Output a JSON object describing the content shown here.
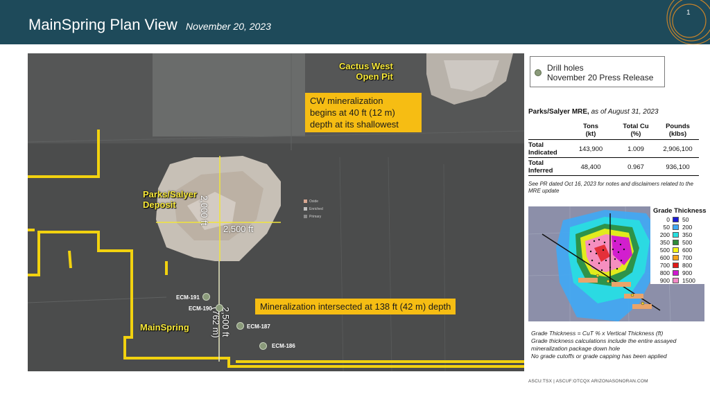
{
  "header": {
    "title": "MainSpring Plan View",
    "date": "November 20, 2023",
    "page_number": "1"
  },
  "map": {
    "labels": {
      "cactus_west": "Cactus West\nOpen Pit",
      "parks_salyer": "Parks/Salyer\nDeposit",
      "mainspring": "MainSpring"
    },
    "callouts": {
      "cw_mineralization": "CW mineralization\nbegins at 40 ft (12 m)\ndepth at its shallowest",
      "mineralization_intersected": "Mineralization intersected at 138 ft (42 m) depth"
    },
    "dimensions": {
      "vertical": "2,000 ft",
      "horizontal": "2,500 ft",
      "mainspring": "2,500 ft\n(762 m)"
    },
    "mini_legend": [
      "Oxide",
      "Enriched",
      "Primary"
    ],
    "drill_holes": [
      "ECM-191",
      "ECM-190",
      "ECM-187",
      "ECM-186"
    ]
  },
  "drill_legend": {
    "line1": "Drill holes",
    "line2": "November 20 Press Release"
  },
  "mre": {
    "title_bold": "Parks/Salyer  MRE,",
    "title_italic": " as of August 31, 2023",
    "columns": [
      "",
      "Tons\n(kt)",
      "Total Cu\n(%)",
      "Pounds\n(klbs)"
    ],
    "rows": [
      {
        "label": "Total\nIndicated",
        "tons": "143,900",
        "cu": "1.009",
        "pounds": "2,906,100"
      },
      {
        "label": "Total\nInferred",
        "tons": "48,400",
        "cu": "0.967",
        "pounds": "936,100"
      }
    ],
    "note": "See PR dated Oct 16, 2023 for notes and disclaimers related to the MRE update"
  },
  "grade_thickness": {
    "title": "Grade Thickness",
    "bins": [
      {
        "lo": "0",
        "hi": "50",
        "color": "#1b1bd6"
      },
      {
        "lo": "50",
        "hi": "200",
        "color": "#3fa9f5"
      },
      {
        "lo": "200",
        "hi": "350",
        "color": "#28e0e0"
      },
      {
        "lo": "350",
        "hi": "500",
        "color": "#2e8b3a"
      },
      {
        "lo": "500",
        "hi": "600",
        "color": "#f5f518"
      },
      {
        "lo": "600",
        "hi": "700",
        "color": "#f5a418"
      },
      {
        "lo": "700",
        "hi": "800",
        "color": "#e01818"
      },
      {
        "lo": "800",
        "hi": "900",
        "color": "#d018d0"
      },
      {
        "lo": "900",
        "hi": "1500",
        "color": "#f58ac8"
      }
    ],
    "note": "Grade Thickness = CuT % x Vertical Thickness (ft)\nGrade thickness calculations include the entire assayed mineralization package down hole\nNo grade cutoffs or grade capping has been applied"
  },
  "footer": "ASCU:TSX | ASCUF:OTCQX   ARIZONASONORAN.COM"
}
